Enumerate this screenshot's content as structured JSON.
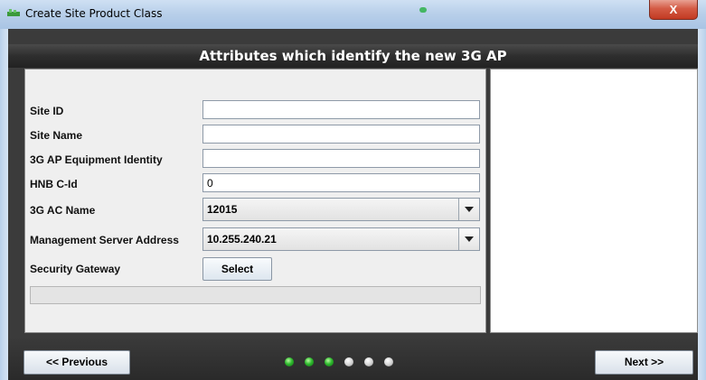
{
  "window": {
    "title": "Create Site Product Class",
    "close_label": "X"
  },
  "header": {
    "title": "Attributes which identify the new 3G AP"
  },
  "form": {
    "site_id": {
      "label": "Site ID",
      "value": ""
    },
    "site_name": {
      "label": "Site Name",
      "value": ""
    },
    "equipment_identity": {
      "label": "3G AP Equipment Identity",
      "value": ""
    },
    "hnb_cid": {
      "label": "HNB C-Id",
      "value": "0"
    },
    "ac_name": {
      "label": "3G AC Name",
      "selected": "12015"
    },
    "mgmt_server": {
      "label": "Management Server Address",
      "selected": "10.255.240.21"
    },
    "security_gateway": {
      "label": "Security Gateway",
      "button_label": "Select"
    }
  },
  "footer": {
    "previous_label": "<< Previous",
    "next_label": "Next >>",
    "steps": [
      {
        "state": "done"
      },
      {
        "state": "done"
      },
      {
        "state": "done"
      },
      {
        "state": "todo"
      },
      {
        "state": "todo"
      },
      {
        "state": "todo"
      }
    ]
  },
  "colors": {
    "step_done": "#2fbb2f",
    "step_todo": "#d5d5d5",
    "header_bg": "#2e2e2e"
  }
}
